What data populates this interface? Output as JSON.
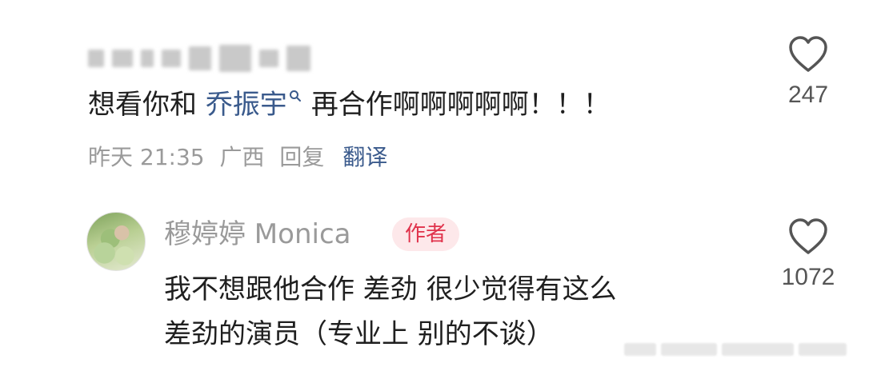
{
  "comment1": {
    "text_prefix": "想看你和 ",
    "mention": "乔振宇",
    "text_suffix": "再合作啊啊啊啊啊！！！",
    "time": "昨天 21:35",
    "location": "广西",
    "reply_label": "回复",
    "translate_label": "翻译",
    "like_count": "247",
    "like_icon": "heart-outline-icon"
  },
  "comment2": {
    "author": "穆婷婷 Monica",
    "badge": "作者",
    "line1": "我不想跟他合作 差劲 很少觉得有这么",
    "line2": "差劲的演员（专业上 别的不谈）",
    "like_count": "1072",
    "like_icon": "heart-outline-icon"
  },
  "colors": {
    "mention": "#3a5a8c",
    "badge_bg": "#fde8ea",
    "badge_text": "#e0334c",
    "meta_text": "#9a9a9a"
  }
}
